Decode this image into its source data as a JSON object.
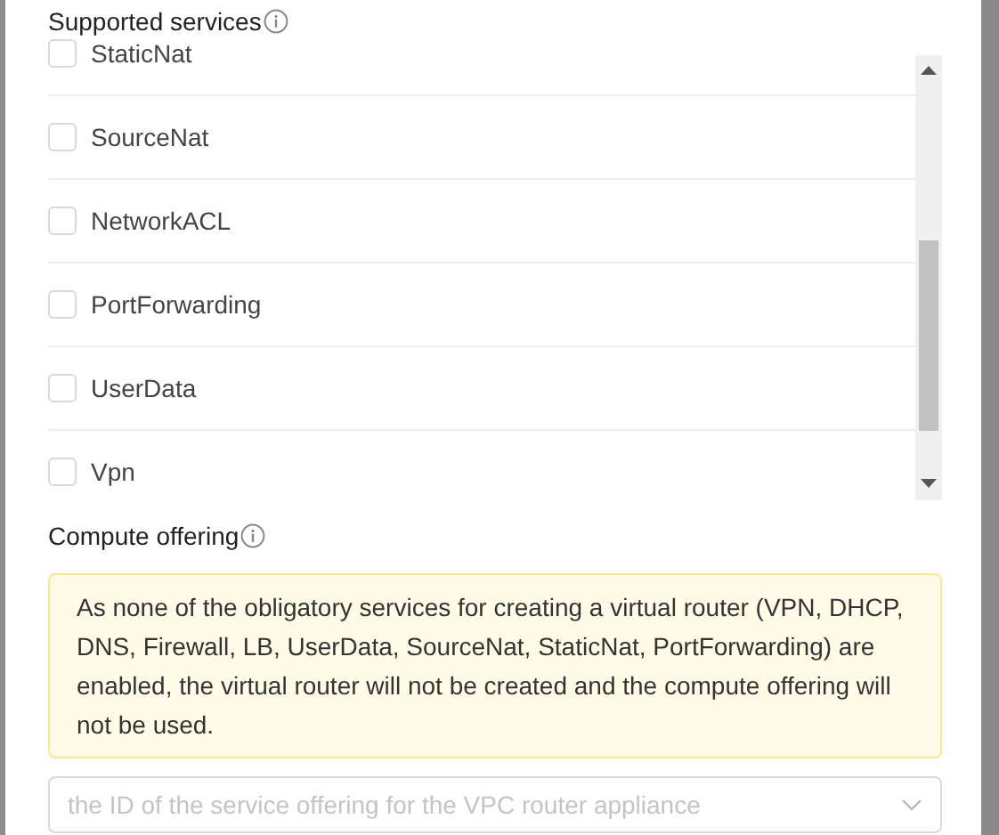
{
  "services": {
    "label": "Supported services",
    "items": [
      {
        "name": "StaticNat",
        "checked": false
      },
      {
        "name": "SourceNat",
        "checked": false
      },
      {
        "name": "NetworkACL",
        "checked": false
      },
      {
        "name": "PortForwarding",
        "checked": false
      },
      {
        "name": "UserData",
        "checked": false
      },
      {
        "name": "Vpn",
        "checked": false
      }
    ]
  },
  "compute_offering": {
    "label": "Compute offering",
    "alert": "As none of the obligatory services for creating a virtual router (VPN, DHCP, DNS, Firewall, LB, UserData, SourceNat, StaticNat, PortForwarding) are enabled, the virtual router will not be created and the compute offering will not be used.",
    "select": {
      "placeholder": "the ID of the service offering for the VPC router appliance",
      "disabled": true
    }
  }
}
